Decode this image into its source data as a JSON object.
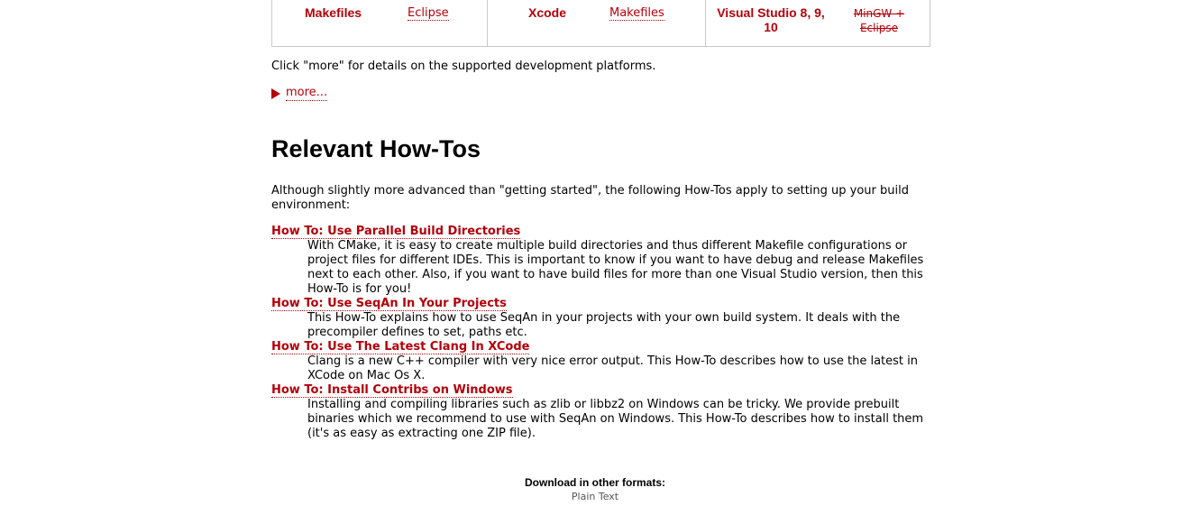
{
  "platforms": {
    "columns": [
      {
        "main": "Makefiles",
        "alt": "Eclipse",
        "alt_struck": false
      },
      {
        "main": "Xcode",
        "alt": "Makefiles",
        "alt_struck": false
      },
      {
        "main": "Visual Studio 8, 9, 10",
        "alt": "MinGW + Eclipse",
        "alt_struck": true
      }
    ]
  },
  "intro_text": "Click \"more\" for details on the supported development platforms.",
  "more_label": "more...",
  "section_title": "Relevant How-Tos",
  "lead_text": "Although slightly more advanced than \"getting started\", the following How-Tos apply to setting up your build environment:",
  "howtos": [
    {
      "title": "How To: Use Parallel Build Directories",
      "description": "With CMake, it is easy to create multiple build directories and thus different Makefile configurations or project files for different IDEs. This is important to know if you want to have debug and release Makefiles next to each other. Also, if you want to have build files for more than one Visual Studio version, then this How-To is for you!"
    },
    {
      "title": "How To: Use SeqAn In Your Projects",
      "description": "This How-To explains how to use SeqAn in your projects with your own build system. It deals with the precompiler defines to set, paths etc."
    },
    {
      "title": "How To: Use The Latest Clang In XCode",
      "description": "Clang is a new C++ compiler with very nice error output. This How-To describes how to use the latest in XCode on Mac Os X."
    },
    {
      "title": "How To: Install Contribs on Windows",
      "description": "Installing and compiling libraries such as zlib or libbz2 on Windows can be tricky. We provide prebuilt binaries which we recommend to use with SeqAn on Windows. This How-To describes how to install them (it's as easy as extracting one ZIP file)."
    }
  ],
  "download": {
    "title": "Download in other formats:",
    "links": [
      "Plain Text"
    ]
  },
  "colors": {
    "link": "#b3000a",
    "text": "#000000",
    "border": "#c9c9c9",
    "muted": "#555555"
  }
}
